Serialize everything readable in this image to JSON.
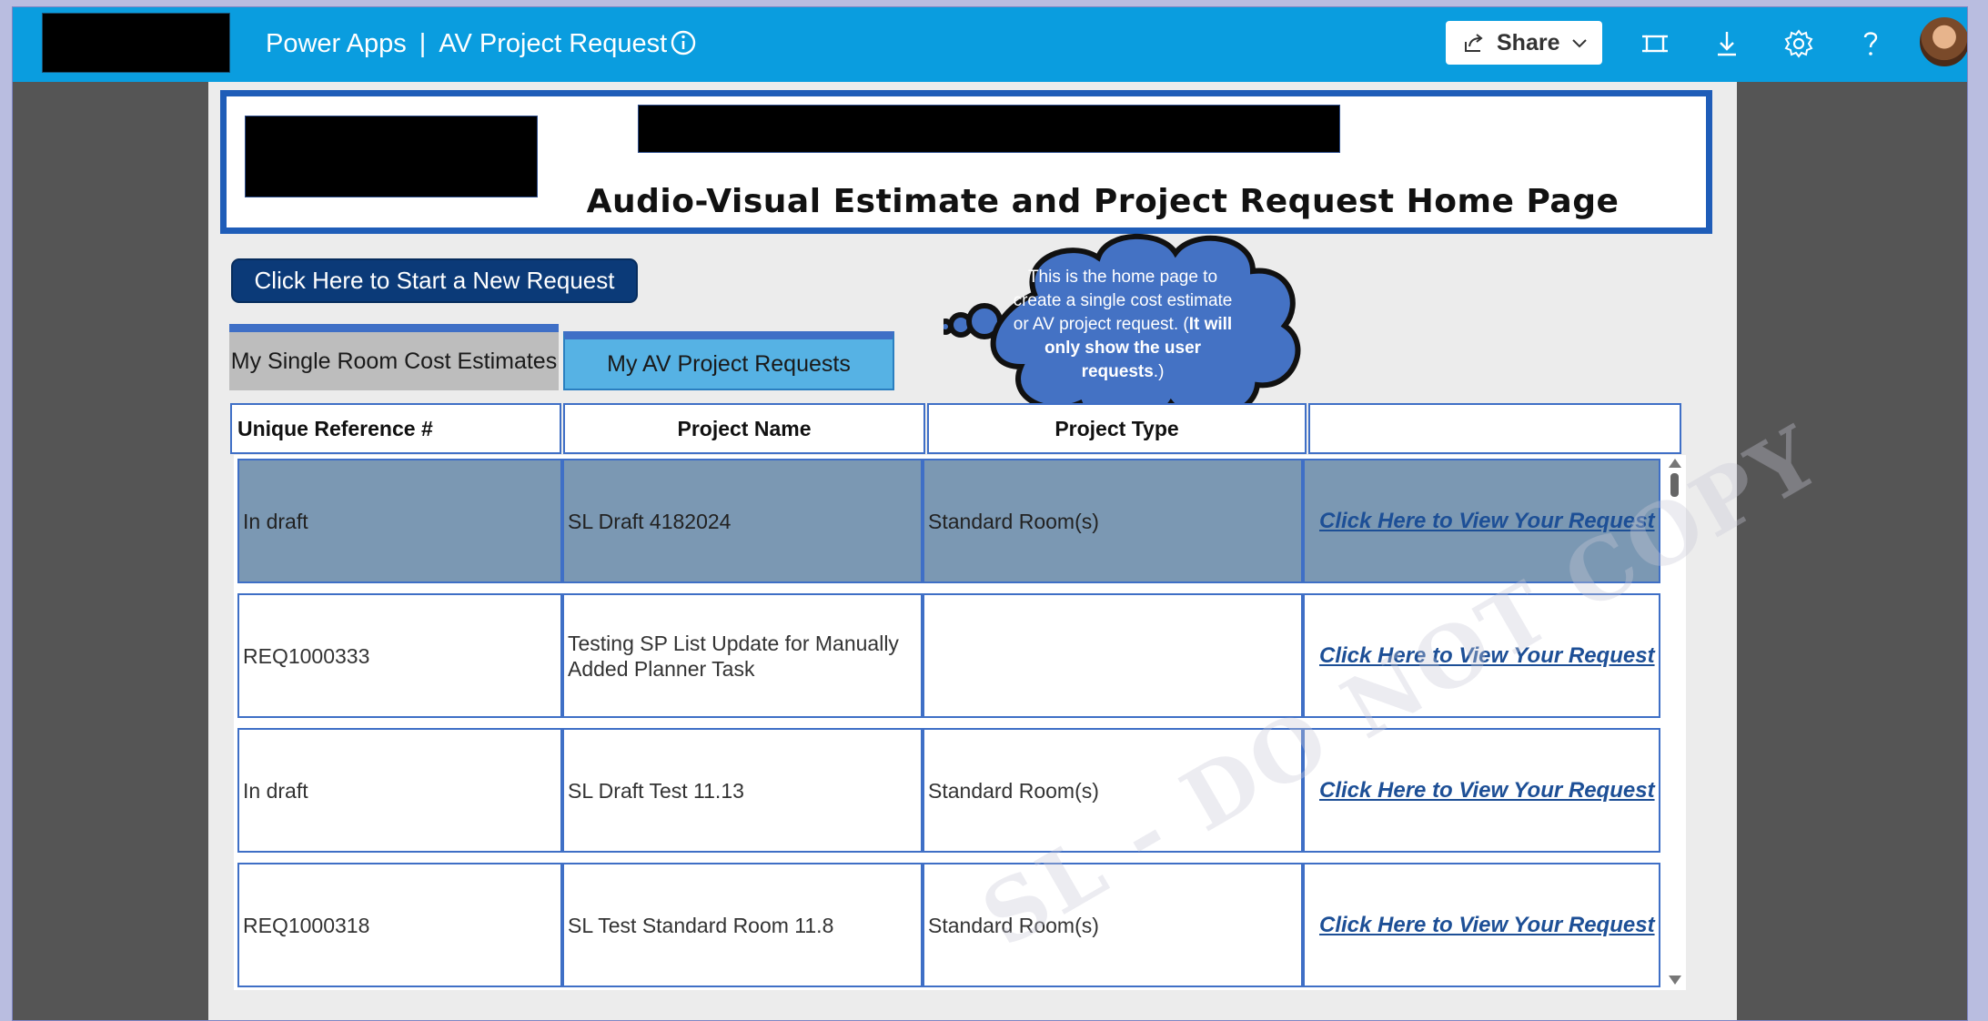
{
  "appbar": {
    "product": "Power Apps",
    "separator": "|",
    "app_name": "AV Project Request",
    "share_label": "Share",
    "bg_color": "#0a9ddf"
  },
  "header": {
    "title": "Audio-Visual Estimate and Project Request Home Page"
  },
  "new_request_button": "Click Here to Start a New Request",
  "tabs": [
    {
      "label": "My Single Room Cost Estimates",
      "active": false
    },
    {
      "label": "My AV Project Requests",
      "active": true
    }
  ],
  "callout": {
    "text": "This is the home page to create a single cost estimate or AV project request. (",
    "bold": "It will only show the user requests",
    "end": ".)"
  },
  "columns": [
    "Unique Reference #",
    "Project Name",
    "Project Type",
    ""
  ],
  "rows": [
    {
      "ref": "In draft",
      "name": "SL Draft 4182024",
      "type": "Standard Room(s)",
      "link": "Click Here to View Your Request",
      "selected": true
    },
    {
      "ref": "REQ1000333",
      "name": "Testing SP List Update for Manually Added Planner Task",
      "type": "",
      "link": "Click Here to View Your Request",
      "selected": false
    },
    {
      "ref": "In draft",
      "name": "SL Draft Test 11.13",
      "type": "Standard Room(s)",
      "link": "Click Here to View Your Request",
      "selected": false
    },
    {
      "ref": "REQ1000318",
      "name": "SL Test Standard Room 11.8",
      "type": "Standard Room(s)",
      "link": "Click Here to View Your Request",
      "selected": false
    }
  ],
  "watermark": "SL - DO NOT COPY",
  "icons": [
    "info-icon",
    "share-icon",
    "chevron-down-icon",
    "fit-screen-icon",
    "download-icon",
    "gear-icon",
    "help-icon",
    "avatar"
  ]
}
